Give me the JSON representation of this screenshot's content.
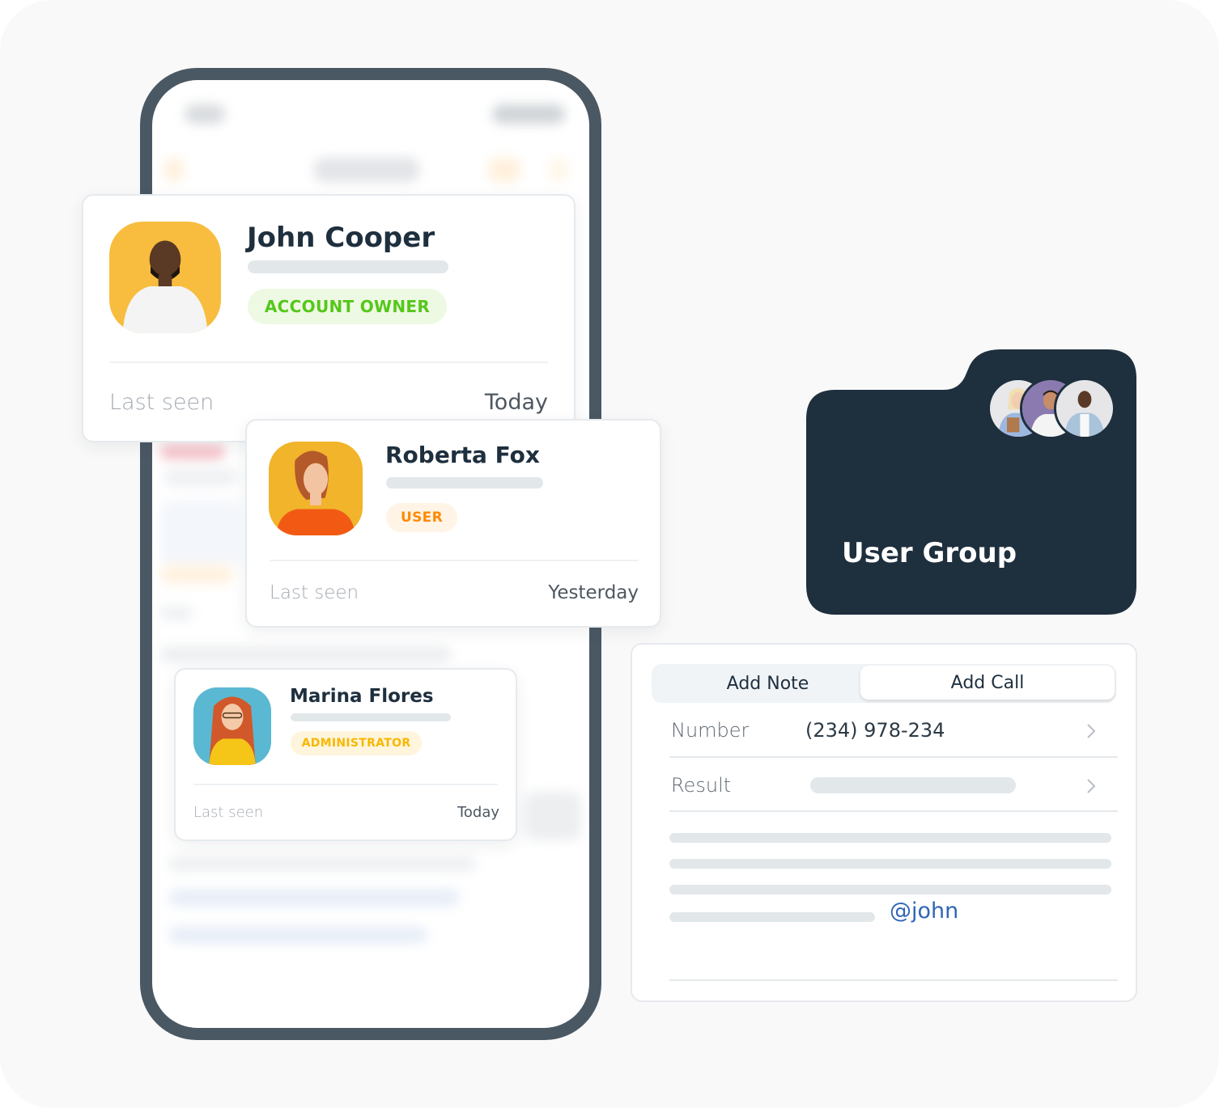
{
  "contacts": [
    {
      "name": "John Cooper",
      "role": "ACCOUNT OWNER",
      "role_color": "#55c71a",
      "role_bg": "#eef9e4",
      "avatar_bg": "#f8bd3f",
      "last_seen_label": "Last seen",
      "last_seen_value": "Today"
    },
    {
      "name": "Roberta Fox",
      "role": "USER",
      "role_color": "#ff8a00",
      "role_bg": "#fff4e6",
      "avatar_bg": "#f1b42a",
      "last_seen_label": "Last seen",
      "last_seen_value": "Yesterday"
    },
    {
      "name": "Marina Flores",
      "role": "ADMINISTRATOR",
      "role_color": "#f8b700",
      "role_bg": "#fff5dd",
      "avatar_bg": "#5ab8d2",
      "last_seen_label": "Last seen",
      "last_seen_value": "Today"
    }
  ],
  "user_group": {
    "title": "User Group",
    "folder_color": "#1e2f3e",
    "member_avatars": [
      "member-woman-blonde",
      "member-man-white-shirt",
      "member-man-denim-shirt"
    ]
  },
  "call_panel": {
    "tabs": [
      {
        "label": "Add Note",
        "active": false
      },
      {
        "label": "Add Call",
        "active": true
      }
    ],
    "fields": [
      {
        "label": "Number",
        "value": "(234) 978-234"
      },
      {
        "label": "Result",
        "value": ""
      }
    ],
    "mention": "@john",
    "mention_color": "#3066b7"
  },
  "colors": {
    "phone_frame": "#4a5864",
    "background": "#f9f9f9",
    "heading": "#1e2f3e"
  }
}
